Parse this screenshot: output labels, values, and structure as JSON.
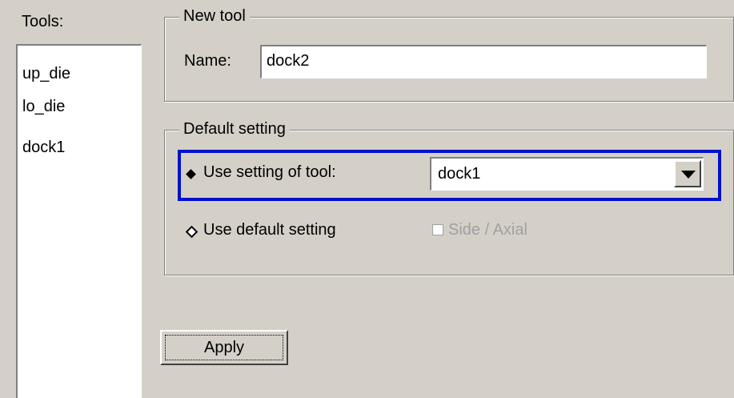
{
  "tools": {
    "label": "Tools:",
    "items": [
      "up_die",
      "lo_die",
      "dock1"
    ]
  },
  "new_tool": {
    "legend": "New tool",
    "name_label": "Name:",
    "name_value": "dock2"
  },
  "default_setting": {
    "legend": "Default setting",
    "option_use_tool": "Use setting of tool:",
    "option_use_tool_selected": true,
    "tool_select_value": "dock1",
    "option_default": "Use default setting",
    "option_default_selected": false,
    "side_axial_label": "Side / Axial",
    "side_axial_checked": false,
    "side_axial_enabled": false
  },
  "apply_label": "Apply",
  "colors": {
    "background": "#d4d0c8",
    "highlight_border": "#0011cc",
    "disabled_text": "#a0a0a0"
  }
}
